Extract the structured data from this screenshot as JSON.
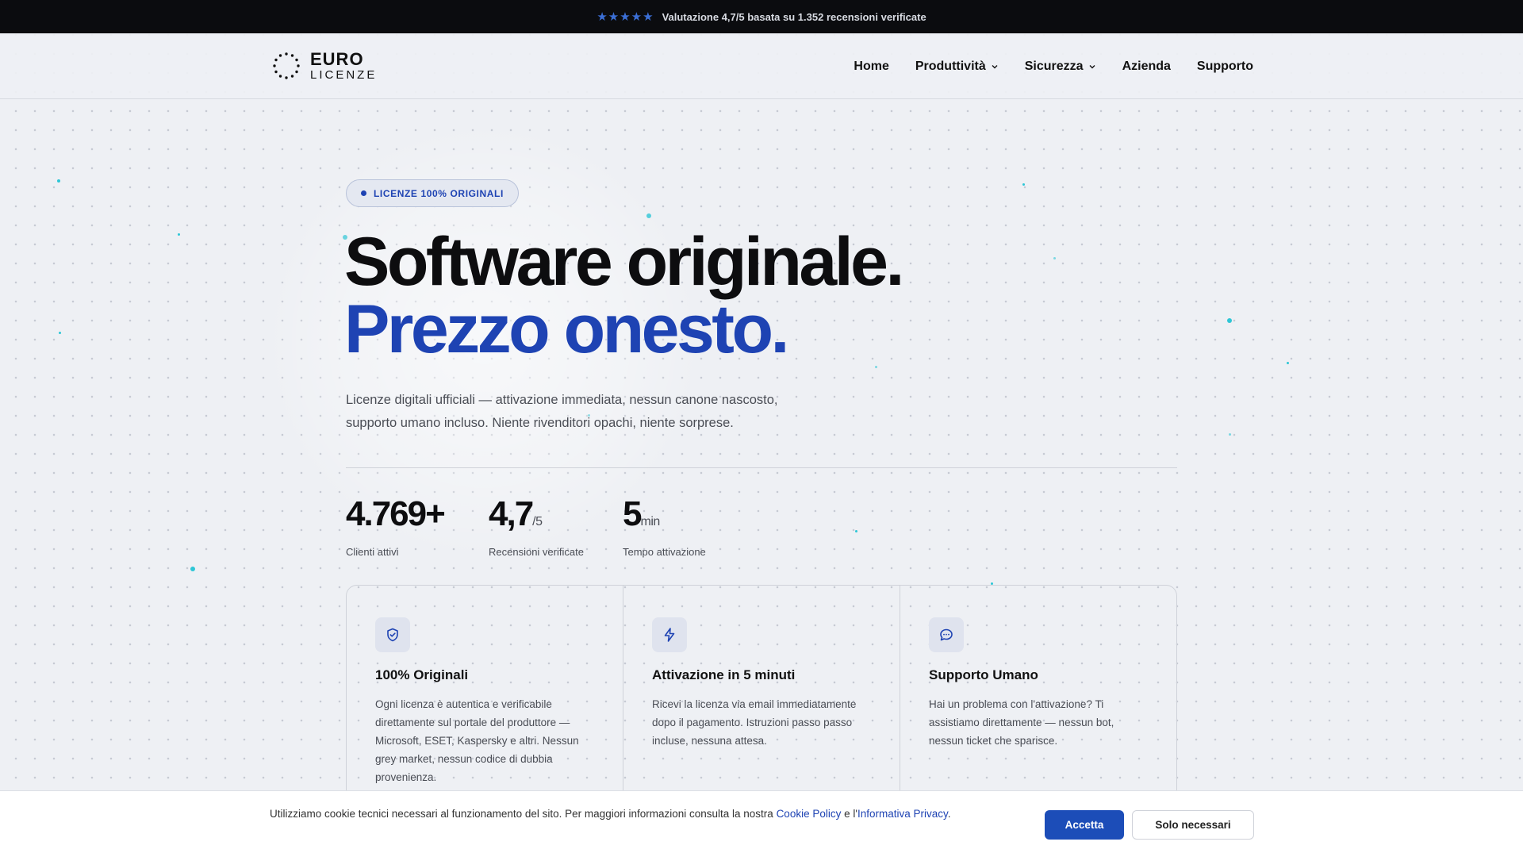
{
  "topbar": {
    "stars": "★★★★★",
    "rating_text": "Valutazione 4,7/5 basata su 1.352 recensioni verificate"
  },
  "header": {
    "logo": {
      "line1": "EURO",
      "line2": "LICENZE"
    },
    "nav": [
      {
        "label": "Home",
        "dropdown": false
      },
      {
        "label": "Produttività",
        "dropdown": true
      },
      {
        "label": "Sicurezza",
        "dropdown": true
      },
      {
        "label": "Azienda",
        "dropdown": false
      },
      {
        "label": "Supporto",
        "dropdown": false
      }
    ]
  },
  "hero": {
    "badge": "LICENZE 100% ORIGINALI",
    "title_line1": "Software originale.",
    "title_line2": "Prezzo onesto.",
    "subtitle_line1": "Licenze digitali ufficiali — attivazione immediata, nessun canone nascosto,",
    "subtitle_line2": "supporto umano incluso. Niente rivenditori opachi, niente sorprese."
  },
  "stats": [
    {
      "value": "4.769+",
      "unit": "",
      "label": "Clienti attivi"
    },
    {
      "value": "4,7",
      "unit": "/5",
      "label": "Recensioni verificate"
    },
    {
      "value": "5",
      "unit": "min",
      "label": "Tempo attivazione"
    }
  ],
  "features": [
    {
      "icon": "shield-check-icon",
      "title": "100% Originali",
      "text": "Ogni licenza è autentica e verificabile direttamente sul portale del produttore — Microsoft, ESET, Kaspersky e altri. Nessun grey market, nessun codice di dubbia provenienza."
    },
    {
      "icon": "lightning-icon",
      "title": "Attivazione in 5 minuti",
      "text": "Ricevi la licenza via email immediatamente dopo il pagamento. Istruzioni passo passo incluse, nessuna attesa."
    },
    {
      "icon": "chat-bubble-icon",
      "title": "Supporto Umano",
      "text": "Hai un problema con l'attivazione? Ti assistiamo direttamente — nessun bot, nessun ticket che sparisce."
    }
  ],
  "cookie": {
    "text_before": "Utilizziamo cookie tecnici necessari al funzionamento del sito. Per maggiori informazioni consulta la nostra ",
    "link_cookie_policy": "Cookie Policy",
    "text_middle": " e l'",
    "link_privacy": "Informativa Privacy",
    "text_after": ".",
    "accept_label": "Accetta",
    "necessary_label": "Solo necessari"
  },
  "colors": {
    "accent": "#1e43b3",
    "button_primary": "#1c4db8",
    "topbar_bg": "#0b0c0f",
    "particle": "#2ec6d6"
  }
}
